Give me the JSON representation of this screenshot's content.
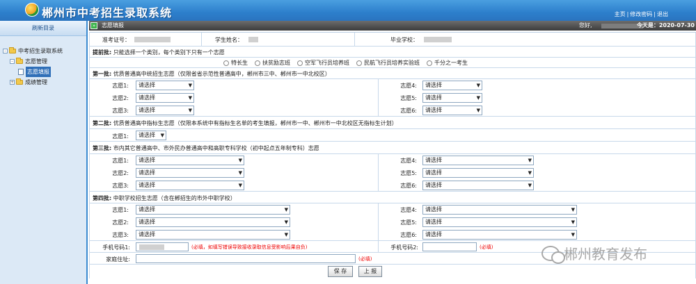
{
  "app": {
    "title": "郴州市中考招生录取系统"
  },
  "header_links": [
    "主页",
    "修改密码",
    "退出"
  ],
  "sidebar": {
    "refresh_label": "刷新目录",
    "tree": {
      "root": "中考招生录取系统",
      "group": "志愿管理",
      "selected": "志愿填报",
      "other": "成绩管理"
    }
  },
  "titlebar": {
    "title": "志愿填报",
    "hello_label": "您好,",
    "today_text": "今天是：2020-07-30"
  },
  "student": {
    "exam_no_label": "准考证号：",
    "name_label": "学生姓名：",
    "school_label": "毕业学校："
  },
  "early_batch": {
    "label": "提前批:",
    "note": "只能选择一个类别，每个类别下只有一个志愿",
    "options": [
      "特长生",
      "扶贫励志班",
      "空军飞行员培养班",
      "民航飞行员培养实验班",
      "千分之一考生"
    ]
  },
  "batch1": {
    "label": "第一批:",
    "note": "优质普通高中统招生志愿（仅限省省示范性普通高中，郴州市三中、郴州市一中北校区）",
    "choices": [
      {
        "label": "志愿1:",
        "value": "请选择"
      },
      {
        "label": "志愿2:",
        "value": "请选择"
      },
      {
        "label": "志愿3:",
        "value": "请选择"
      },
      {
        "label": "志愿4:",
        "value": "请选择"
      },
      {
        "label": "志愿5:",
        "value": "请选择"
      },
      {
        "label": "志愿6:",
        "value": "请选择"
      }
    ]
  },
  "batch2": {
    "label": "第二批:",
    "note": "优质普通高中指标生志愿（仅限本系统中有指标生名单的考生填报，郴州市一中、郴州市一中北校区无指标生计划）",
    "choice": {
      "label": "志愿1:",
      "value": "请选择"
    }
  },
  "batch3": {
    "label": "第三批:",
    "note": "市内其它普通高中、市外民办普通高中和高职专科学校（初中起点五年制专科）志愿",
    "choices": [
      {
        "label": "志愿1:",
        "value": "请选择"
      },
      {
        "label": "志愿2:",
        "value": "请选择"
      },
      {
        "label": "志愿3:",
        "value": "请选择"
      },
      {
        "label": "志愿4:",
        "value": "请选择"
      },
      {
        "label": "志愿5:",
        "value": "请选择"
      },
      {
        "label": "志愿6:",
        "value": "请选择"
      }
    ]
  },
  "batch4": {
    "label": "第四批:",
    "note": "中职学校招生志愿（含在郴招生的市外中职学校）",
    "choices": [
      {
        "label": "志愿1:",
        "value": "请选择"
      },
      {
        "label": "志愿2:",
        "value": "请选择"
      },
      {
        "label": "志愿3:",
        "value": "请选择"
      },
      {
        "label": "志愿4:",
        "value": "请选择"
      },
      {
        "label": "志愿5:",
        "value": "请选择"
      },
      {
        "label": "志愿6:",
        "value": "请选择"
      }
    ]
  },
  "contact": {
    "phone1_label": "手机号码1:",
    "phone1_note": "(必填，如填写错误导致接收录取信息受影响后果自负)",
    "phone2_label": "手机号码2:",
    "phone2_note": "(必填)",
    "address_label": "家庭住址:",
    "address_note": "(必填)"
  },
  "buttons": {
    "save": "保 存",
    "submit": "上 报"
  },
  "watermark": "郴州教育发布",
  "colors": {
    "header_blue": "#2d7fcc",
    "sidebar_bg": "#dce9f6",
    "titlebar_gray": "#4a4a4a",
    "required_red": "#e00000",
    "selected_blue": "#2f6fb8"
  }
}
